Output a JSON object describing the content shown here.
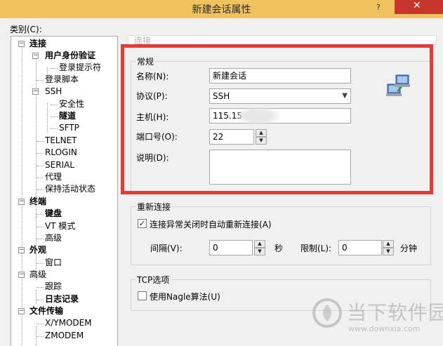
{
  "window": {
    "title": "新建会话属性",
    "help": "?",
    "close": "✕"
  },
  "category_label": "类别(C):",
  "tree": [
    {
      "label": "连接",
      "bold": true,
      "expander": "−"
    },
    {
      "label": "用户身份验证",
      "bold": true,
      "expander": "−"
    },
    {
      "label": "登录提示符",
      "bold": false,
      "expander": ""
    },
    {
      "label": "登录脚本",
      "bold": false,
      "expander": ""
    },
    {
      "label": "SSH",
      "bold": false,
      "expander": "−"
    },
    {
      "label": "安全性",
      "bold": false,
      "expander": ""
    },
    {
      "label": "隧道",
      "bold": true,
      "expander": ""
    },
    {
      "label": "SFTP",
      "bold": false,
      "expander": ""
    },
    {
      "label": "TELNET",
      "bold": false,
      "expander": ""
    },
    {
      "label": "RLOGIN",
      "bold": false,
      "expander": ""
    },
    {
      "label": "SERIAL",
      "bold": false,
      "expander": ""
    },
    {
      "label": "代理",
      "bold": false,
      "expander": ""
    },
    {
      "label": "保持活动状态",
      "bold": false,
      "expander": ""
    },
    {
      "label": "终端",
      "bold": true,
      "expander": "−"
    },
    {
      "label": "键盘",
      "bold": true,
      "expander": ""
    },
    {
      "label": "VT 模式",
      "bold": false,
      "expander": ""
    },
    {
      "label": "高级",
      "bold": false,
      "expander": ""
    },
    {
      "label": "外观",
      "bold": true,
      "expander": "−"
    },
    {
      "label": "窗口",
      "bold": false,
      "expander": ""
    },
    {
      "label": "高级",
      "bold": false,
      "expander": "−"
    },
    {
      "label": "跟踪",
      "bold": false,
      "expander": ""
    },
    {
      "label": "日志记录",
      "bold": true,
      "expander": ""
    },
    {
      "label": "文件传输",
      "bold": true,
      "expander": "−"
    },
    {
      "label": "X/YMODEM",
      "bold": false,
      "expander": ""
    },
    {
      "label": "ZMODEM",
      "bold": false,
      "expander": ""
    }
  ],
  "section_header": "连接",
  "general": {
    "title": "常规",
    "name_label": "名称(N):",
    "name_value": "新建会话",
    "protocol_label": "协议(P):",
    "protocol_value": "SSH",
    "host_label": "主机(H):",
    "host_value": "115.15",
    "port_label": "端口号(O):",
    "port_value": "22",
    "desc_label": "说明(D):"
  },
  "reconnect": {
    "title": "重新连接",
    "auto_label": "连接异常关闭时自动重新连接(A)",
    "auto_checked": "✓",
    "interval_label": "间隔(V):",
    "interval_value": "0",
    "interval_unit": "秒",
    "limit_label": "限制(L):",
    "limit_value": "0",
    "limit_unit": "分钟"
  },
  "tcp": {
    "title": "TCP选项",
    "nagle_label": "使用Nagle算法(U)",
    "nagle_checked": ""
  },
  "watermark": {
    "text": "当下软件园",
    "url": "www.downxia.com"
  },
  "colors": {
    "title_bar": "#f0c35e",
    "close_button": "#c8352b",
    "highlight_frame": "#e53a3a"
  }
}
